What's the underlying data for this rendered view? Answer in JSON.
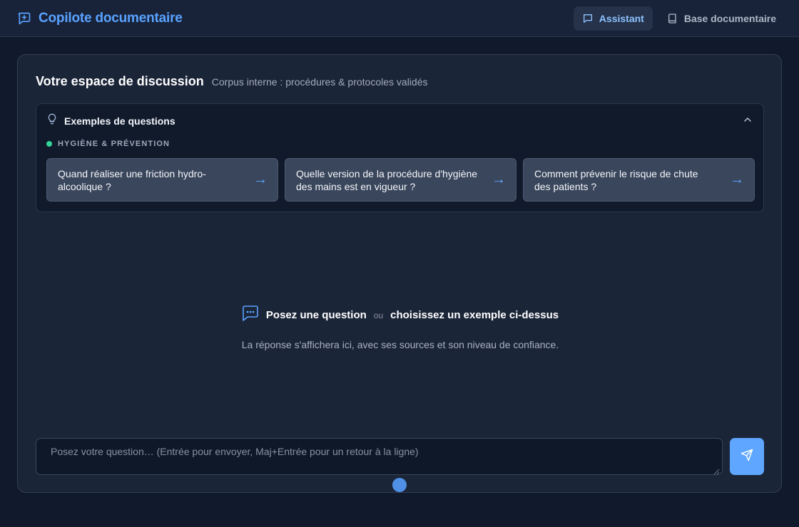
{
  "app": {
    "title": "Copilote documentaire"
  },
  "nav": [
    {
      "label": "Assistant",
      "icon": "chat-bubble-icon",
      "active": true
    },
    {
      "label": "Base documentaire",
      "icon": "book-icon",
      "active": false
    }
  ],
  "panel": {
    "title": "Votre espace de discussion",
    "subtitle": "Corpus interne : procédures & protocoles validés"
  },
  "examples": {
    "title": "Exemples de questions",
    "category": "HYGIÈNE & PRÉVENTION",
    "category_color": "#34d399",
    "items": [
      "Quand réaliser une friction hydro-alcoolique ?",
      "Quelle version de la procédure d'hygiène des mains est en vigueur ?",
      "Comment prévenir le risque de chute des patients ?"
    ],
    "arrow": "→"
  },
  "empty_state": {
    "primary": "Posez une question",
    "separator": "ou",
    "secondary": "choisissez un exemple ci-dessus",
    "hint": "La réponse s'affichera ici, avec ses sources et son niveau de confiance."
  },
  "composer": {
    "placeholder": "Posez votre question…  (Entrée pour envoyer, Maj+Entrée pour un retour à la ligne)",
    "value": ""
  },
  "colors": {
    "accent": "#5aa2ff",
    "background": "#101a2c",
    "panel": "#1b2538"
  }
}
